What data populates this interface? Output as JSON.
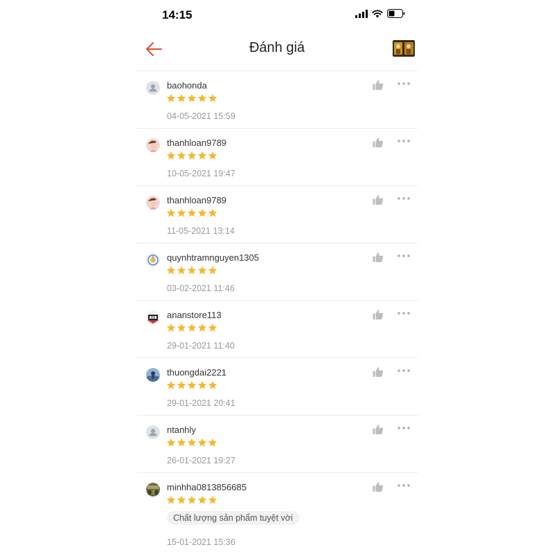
{
  "status_bar": {
    "time": "14:15"
  },
  "header": {
    "title": "Đánh giá",
    "back_icon": "arrow-left-icon",
    "accent_color": "#d94f2f"
  },
  "star_color": "#f5b833",
  "reviews": [
    {
      "username": "baohonda",
      "rating": 5,
      "date": "04-05-2021 15:59",
      "comment": ""
    },
    {
      "username": "thanhloan9789",
      "rating": 5,
      "date": "10-05-2021 19:47",
      "comment": ""
    },
    {
      "username": "thanhloan9789",
      "rating": 5,
      "date": "11-05-2021 13:14",
      "comment": ""
    },
    {
      "username": "quynhtramnguyen1305",
      "rating": 5,
      "date": "03-02-2021 11:46",
      "comment": ""
    },
    {
      "username": "ananstore113",
      "rating": 5,
      "date": "29-01-2021 11:40",
      "comment": ""
    },
    {
      "username": "thuongdai2221",
      "rating": 5,
      "date": "29-01-2021 20:41",
      "comment": ""
    },
    {
      "username": "ntanhly",
      "rating": 5,
      "date": "26-01-2021 19:27",
      "comment": ""
    },
    {
      "username": "minhha0813856685",
      "rating": 5,
      "date": "15-01-2021 15:36",
      "comment": "Chất lượng sản phẩm tuyệt vời"
    }
  ]
}
